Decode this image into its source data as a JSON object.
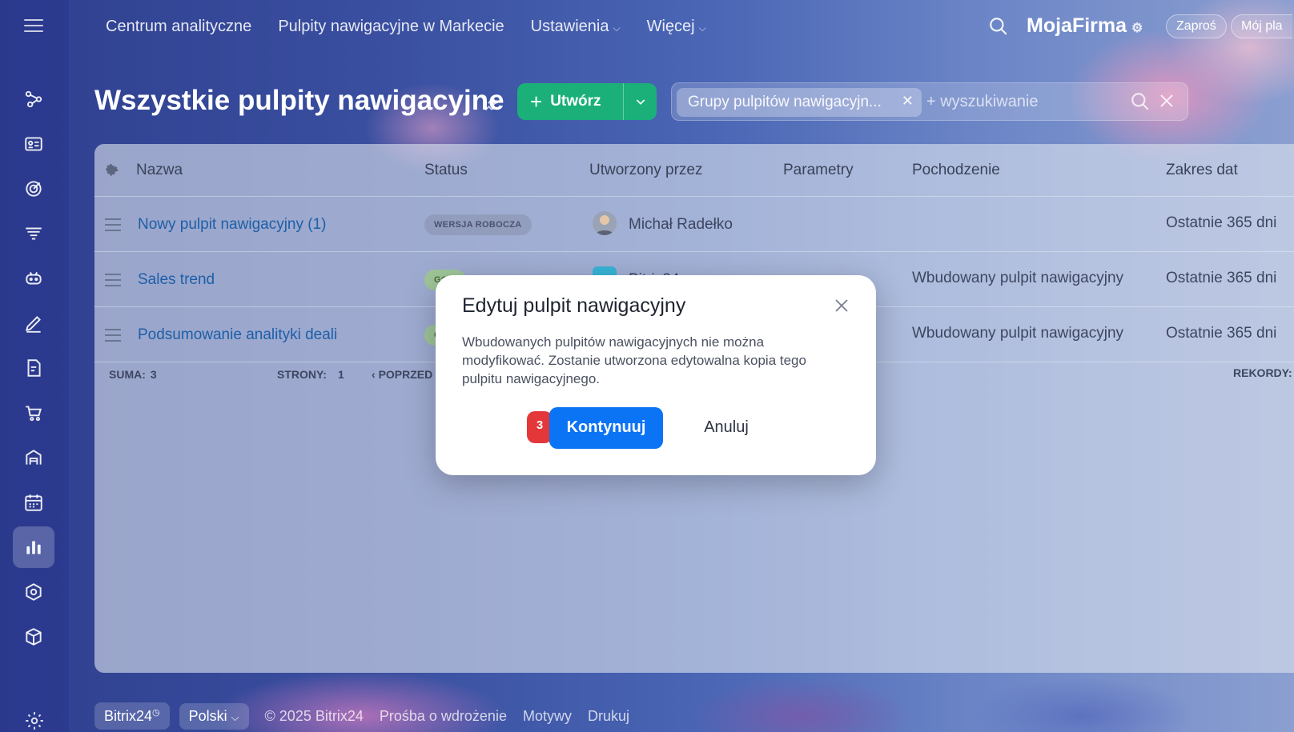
{
  "topnav": {
    "items": [
      {
        "label": "Centrum analityczne"
      },
      {
        "label": "Pulpity nawigacyjne w Markecie"
      },
      {
        "label": "Ustawienia"
      },
      {
        "label": "Więcej"
      }
    ],
    "brand": "MojaFirma",
    "invite_label": "Zaproś",
    "plan_label": "Mój pla"
  },
  "page": {
    "title": "Wszystkie pulpity nawigacyjne",
    "create_label": "Utwórz"
  },
  "filter": {
    "chip_label": "Grupy pulpitów nawigacyjn...",
    "search_placeholder": "+ wyszukiwanie"
  },
  "grid": {
    "columns": [
      "Nazwa",
      "Status",
      "Utworzony przez",
      "Parametry",
      "Pochodzenie",
      "Zakres dat"
    ],
    "rows": [
      {
        "name": "Nowy pulpit nawigacyjny (1)",
        "status": "WERSJA ROBOCZA",
        "creator": "Michał Radełko",
        "origin": "",
        "range": "Ostatnie 365 dni"
      },
      {
        "name": "Sales trend",
        "status": "GO...",
        "creator": "Bitrix24",
        "origin": "Wbudowany pulpit nawigacyjny",
        "range": "Ostatnie 365 dni"
      },
      {
        "name": "Podsumowanie analityki deali",
        "status": "G...",
        "creator": "",
        "origin": "Wbudowany pulpit nawigacyjny",
        "range": "Ostatnie 365 dni"
      }
    ],
    "footer": {
      "total_label": "SUMA:",
      "total_value": "3",
      "pages_label": "STRONY:",
      "pages_value": "1",
      "prev_label": "POPRZED",
      "records_label": "REKORDY:"
    }
  },
  "page_footer": {
    "bitrix_label": "Bitrix24",
    "language": "Polski",
    "copyright": "© 2025 Bitrix24",
    "links": [
      "Prośba o wdrożenie",
      "Motywy",
      "Drukuj"
    ]
  },
  "modal": {
    "title": "Edytuj pulpit nawigacyjny",
    "text": "Wbudowanych pulpitów nawigacyjnych nie można modyfikować. Zostanie utworzona edytowalna kopia tego pulpitu nawigacyjnego.",
    "step_marker": "3",
    "continue_label": "Kontynuuj",
    "cancel_label": "Anuluj"
  },
  "colors": {
    "primary_button": "#0b74f5",
    "create_button": "#1bb07a",
    "marker": "#e3373a"
  }
}
